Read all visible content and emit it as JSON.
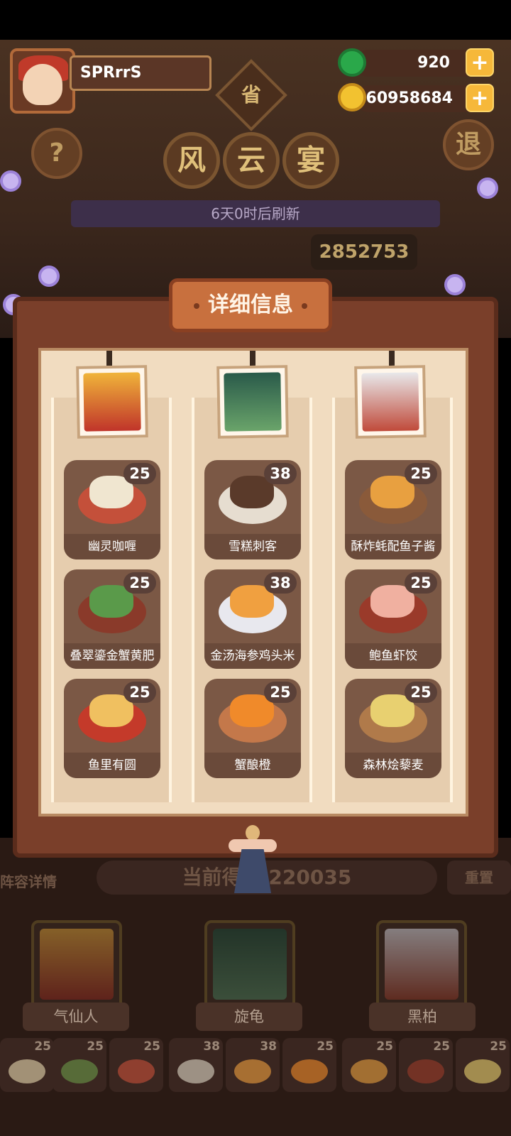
{
  "player": {
    "name": "SPRrrS"
  },
  "currency": {
    "jade": "920",
    "coins": "60958684",
    "add_symbol": "+"
  },
  "header": {
    "help_symbol": "?",
    "exit_label": "退",
    "province_char": "省",
    "title_chars": [
      "风",
      "云",
      "宴"
    ],
    "refresh_text": "6天0时后刷新",
    "top_score": "2852753"
  },
  "modal": {
    "title": "详细信息",
    "columns": [
      {
        "dishes": [
          {
            "name": "幽灵咖喱",
            "level": "25"
          },
          {
            "name": "叠翠鎏金蟹黄肥",
            "level": "25"
          },
          {
            "name": "鱼里有圆",
            "level": "25"
          }
        ]
      },
      {
        "dishes": [
          {
            "name": "雪糕刺客",
            "level": "38"
          },
          {
            "name": "金汤海参鸡头米",
            "level": "38"
          },
          {
            "name": "蟹酿橙",
            "level": "25"
          }
        ]
      },
      {
        "dishes": [
          {
            "name": "酥炸蚝配鱼子酱",
            "level": "25"
          },
          {
            "name": "鲍鱼虾饺",
            "level": "25"
          },
          {
            "name": "森林烩藜麦",
            "level": "25"
          }
        ]
      }
    ]
  },
  "bottom": {
    "lineup_label": "阵容详情",
    "current_score": "当前得分 220035",
    "reset_label": "重置",
    "heroes": [
      {
        "name": "气仙人"
      },
      {
        "name": "旋龟"
      },
      {
        "name": "黑柏"
      }
    ],
    "dish_counts": [
      "25",
      "25",
      "25",
      "38",
      "38",
      "25",
      "25",
      "25",
      "25"
    ]
  },
  "colors": {
    "accent_gold": "#f6b83a",
    "panel_brown": "#7a3f2a",
    "paper": "#f1dcc0"
  },
  "icons": [
    "jade-icon",
    "coin-icon",
    "plus-icon",
    "help-icon",
    "exit-icon",
    "flower-icon",
    "tassel-icon"
  ]
}
